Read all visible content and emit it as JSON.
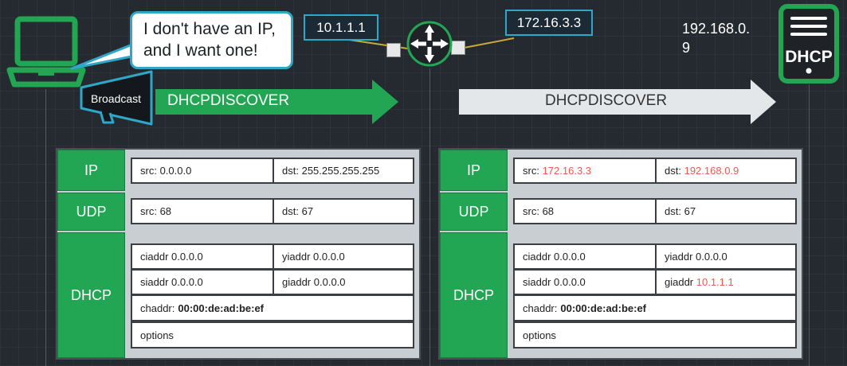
{
  "client": {
    "icon": "laptop-icon",
    "speech": [
      "I don't have an IP,",
      "and I want one!"
    ]
  },
  "broadcast_label": "Broadcast",
  "relay": {
    "icon": "router-icon",
    "left_ip": "10.1.1.1",
    "right_ip": "172.16.3.3"
  },
  "server": {
    "ip_line1": "192.168.0.",
    "ip_line2": "9",
    "icon_label": "DHCP"
  },
  "arrows": {
    "left": "DHCPDISCOVER",
    "right": "DHCPDISCOVER"
  },
  "colors": {
    "green": "#22a653",
    "bubble_border": "#2fa7c9",
    "highlight": "#e85a4f",
    "background": "#252a30"
  },
  "left_packet": {
    "ip": {
      "label": "IP",
      "src_key": "src:",
      "src": "0.0.0.0",
      "dst_key": "dst:",
      "dst": "255.255.255.255"
    },
    "udp": {
      "label": "UDP",
      "src_key": "src:",
      "src": "68",
      "dst_key": "dst:",
      "dst": "67"
    },
    "dhcp": {
      "label": "DHCP",
      "ciaddr": "ciaddr 0.0.0.0",
      "yiaddr": "yiaddr 0.0.0.0",
      "siaddr": "siaddr 0.0.0.0",
      "giaddr_key": "giaddr",
      "giaddr": "0.0.0.0",
      "chaddr_key": "chaddr:",
      "chaddr": "00:00:de:ad:be:ef",
      "options": "options"
    }
  },
  "right_packet": {
    "ip": {
      "label": "IP",
      "src_key": "src:",
      "src": "172.16.3.3",
      "dst_key": "dst:",
      "dst": "192.168.0.9"
    },
    "udp": {
      "label": "UDP",
      "src_key": "src:",
      "src": "68",
      "dst_key": "dst:",
      "dst": "67"
    },
    "dhcp": {
      "label": "DHCP",
      "ciaddr": "ciaddr 0.0.0.0",
      "yiaddr": "yiaddr 0.0.0.0",
      "siaddr": "siaddr 0.0.0.0",
      "giaddr_key": "giaddr",
      "giaddr": "10.1.1.1",
      "chaddr_key": "chaddr:",
      "chaddr": "00:00:de:ad:be:ef",
      "options": "options"
    }
  }
}
